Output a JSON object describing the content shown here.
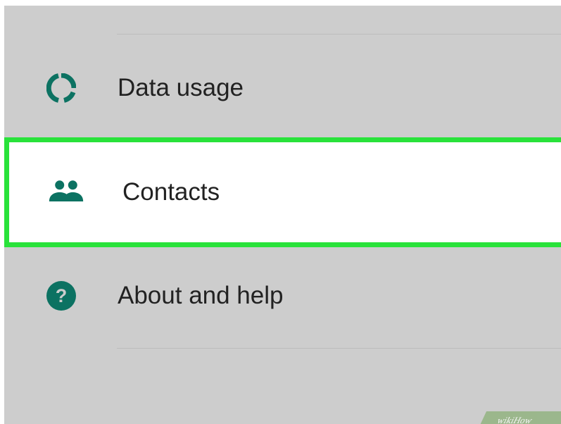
{
  "menu": {
    "items": [
      {
        "label": "Data usage",
        "icon": "data-usage-icon"
      },
      {
        "label": "Contacts",
        "icon": "contacts-icon",
        "highlighted": true
      },
      {
        "label": "About and help",
        "icon": "help-icon"
      }
    ]
  },
  "colors": {
    "background": "#cdcdcd",
    "icon": "#0c7262",
    "highlight_border": "#29e23a",
    "highlight_bg": "#ffffff",
    "text": "#222222"
  },
  "watermark": {
    "text": "wikiHow"
  }
}
